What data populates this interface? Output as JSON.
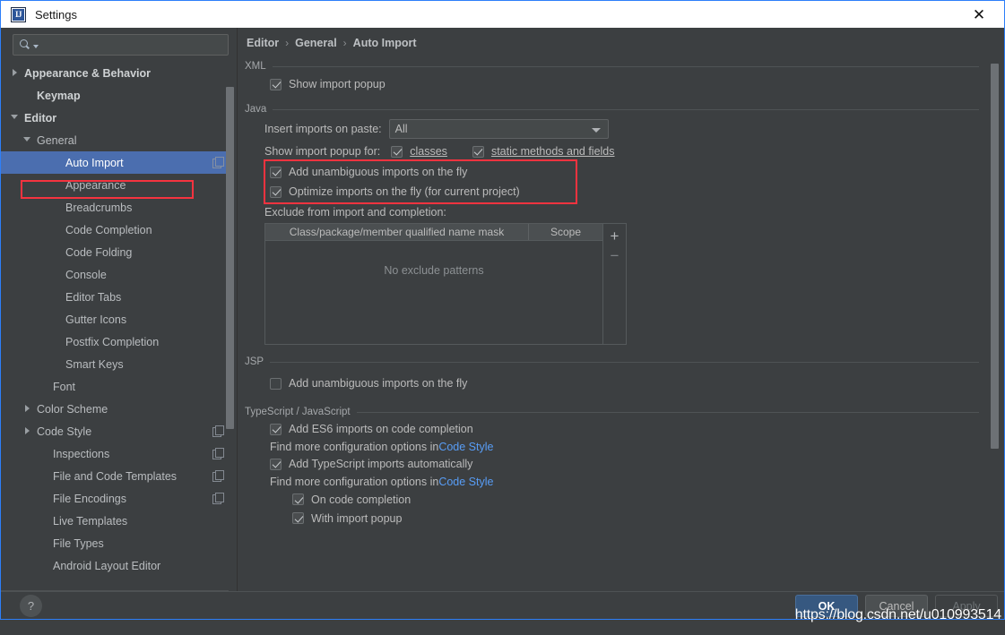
{
  "window": {
    "title": "Settings",
    "logo_text": "IJ",
    "close_icon": "✕"
  },
  "sidebar": {
    "search": {
      "value": "",
      "placeholder": ""
    },
    "items": [
      {
        "label": "Appearance & Behavior",
        "twisty": "right",
        "indent": 0,
        "bold": true,
        "selected": false,
        "copy": false
      },
      {
        "label": "Keymap",
        "twisty": "none",
        "indent": 1,
        "bold": true,
        "selected": false,
        "copy": false
      },
      {
        "label": "Editor",
        "twisty": "down",
        "indent": 0,
        "bold": true,
        "selected": false,
        "copy": false
      },
      {
        "label": "General",
        "twisty": "down",
        "indent": 1,
        "bold": false,
        "selected": false,
        "copy": false
      },
      {
        "label": "Auto Import",
        "twisty": "none",
        "indent": 3,
        "bold": false,
        "selected": true,
        "copy": true
      },
      {
        "label": "Appearance",
        "twisty": "none",
        "indent": 3,
        "bold": false,
        "selected": false,
        "copy": false
      },
      {
        "label": "Breadcrumbs",
        "twisty": "none",
        "indent": 3,
        "bold": false,
        "selected": false,
        "copy": false
      },
      {
        "label": "Code Completion",
        "twisty": "none",
        "indent": 3,
        "bold": false,
        "selected": false,
        "copy": false
      },
      {
        "label": "Code Folding",
        "twisty": "none",
        "indent": 3,
        "bold": false,
        "selected": false,
        "copy": false
      },
      {
        "label": "Console",
        "twisty": "none",
        "indent": 3,
        "bold": false,
        "selected": false,
        "copy": false
      },
      {
        "label": "Editor Tabs",
        "twisty": "none",
        "indent": 3,
        "bold": false,
        "selected": false,
        "copy": false
      },
      {
        "label": "Gutter Icons",
        "twisty": "none",
        "indent": 3,
        "bold": false,
        "selected": false,
        "copy": false
      },
      {
        "label": "Postfix Completion",
        "twisty": "none",
        "indent": 3,
        "bold": false,
        "selected": false,
        "copy": false
      },
      {
        "label": "Smart Keys",
        "twisty": "none",
        "indent": 3,
        "bold": false,
        "selected": false,
        "copy": false
      },
      {
        "label": "Font",
        "twisty": "none",
        "indent": 2,
        "bold": false,
        "selected": false,
        "copy": false
      },
      {
        "label": "Color Scheme",
        "twisty": "right",
        "indent": 1,
        "bold": false,
        "selected": false,
        "copy": false
      },
      {
        "label": "Code Style",
        "twisty": "right",
        "indent": 1,
        "bold": false,
        "selected": false,
        "copy": true
      },
      {
        "label": "Inspections",
        "twisty": "none",
        "indent": 2,
        "bold": false,
        "selected": false,
        "copy": true
      },
      {
        "label": "File and Code Templates",
        "twisty": "none",
        "indent": 2,
        "bold": false,
        "selected": false,
        "copy": true
      },
      {
        "label": "File Encodings",
        "twisty": "none",
        "indent": 2,
        "bold": false,
        "selected": false,
        "copy": true
      },
      {
        "label": "Live Templates",
        "twisty": "none",
        "indent": 2,
        "bold": false,
        "selected": false,
        "copy": false
      },
      {
        "label": "File Types",
        "twisty": "none",
        "indent": 2,
        "bold": false,
        "selected": false,
        "copy": false
      },
      {
        "label": "Android Layout Editor",
        "twisty": "none",
        "indent": 2,
        "bold": false,
        "selected": false,
        "copy": false
      }
    ]
  },
  "breadcrumb": {
    "items": [
      "Editor",
      "General",
      "Auto Import"
    ],
    "separator": "›"
  },
  "sections": {
    "xml": {
      "title": "XML",
      "show_import_popup": {
        "label": "Show import popup",
        "checked": true
      }
    },
    "java": {
      "title": "Java",
      "insert_imports_label": "Insert imports on paste:",
      "insert_imports_value": "All",
      "show_popup_for_label": "Show import popup for:",
      "classes": {
        "label": "classes",
        "checked": true,
        "mnemonic": "c"
      },
      "static_methods": {
        "label": "static methods and fields",
        "checked": true,
        "mnemonic": "s"
      },
      "add_unambiguous": {
        "label": "Add unambiguous imports on the fly",
        "checked": true
      },
      "optimize_imports": {
        "label": "Optimize imports on the fly (for current project)",
        "checked": true
      },
      "exclude_label": "Exclude from import and completion:",
      "table": {
        "columns": [
          "Class/package/member qualified name mask",
          "Scope"
        ],
        "rows": [],
        "empty_text": "No exclude patterns",
        "add_button": "+",
        "remove_button": "−"
      }
    },
    "jsp": {
      "title": "JSP",
      "add_unambiguous": {
        "label": "Add unambiguous imports on the fly",
        "checked": false
      }
    },
    "ts_js": {
      "title": "TypeScript / JavaScript",
      "add_es6": {
        "label": "Add ES6 imports on code completion",
        "checked": true
      },
      "hint1_prefix": "Find more configuration options in ",
      "hint1_link": "Code Style",
      "add_ts": {
        "label": "Add TypeScript imports automatically",
        "checked": true
      },
      "hint2_prefix": "Find more configuration options in ",
      "hint2_link": "Code Style",
      "on_code_completion": {
        "label": "On code completion",
        "checked": true
      },
      "with_import_popup": {
        "label": "With import popup",
        "checked": true
      }
    }
  },
  "footer": {
    "help": "?",
    "ok": "OK",
    "cancel": "Cancel",
    "apply": "Apply"
  },
  "watermark": "https://blog.csdn.net/u010993514",
  "colors": {
    "accent_blue": "#4b6eaf",
    "window_border": "#2d7ff9",
    "highlight_red": "#f5333f",
    "link_blue": "#589df6",
    "panel_bg": "#3c3f41"
  }
}
